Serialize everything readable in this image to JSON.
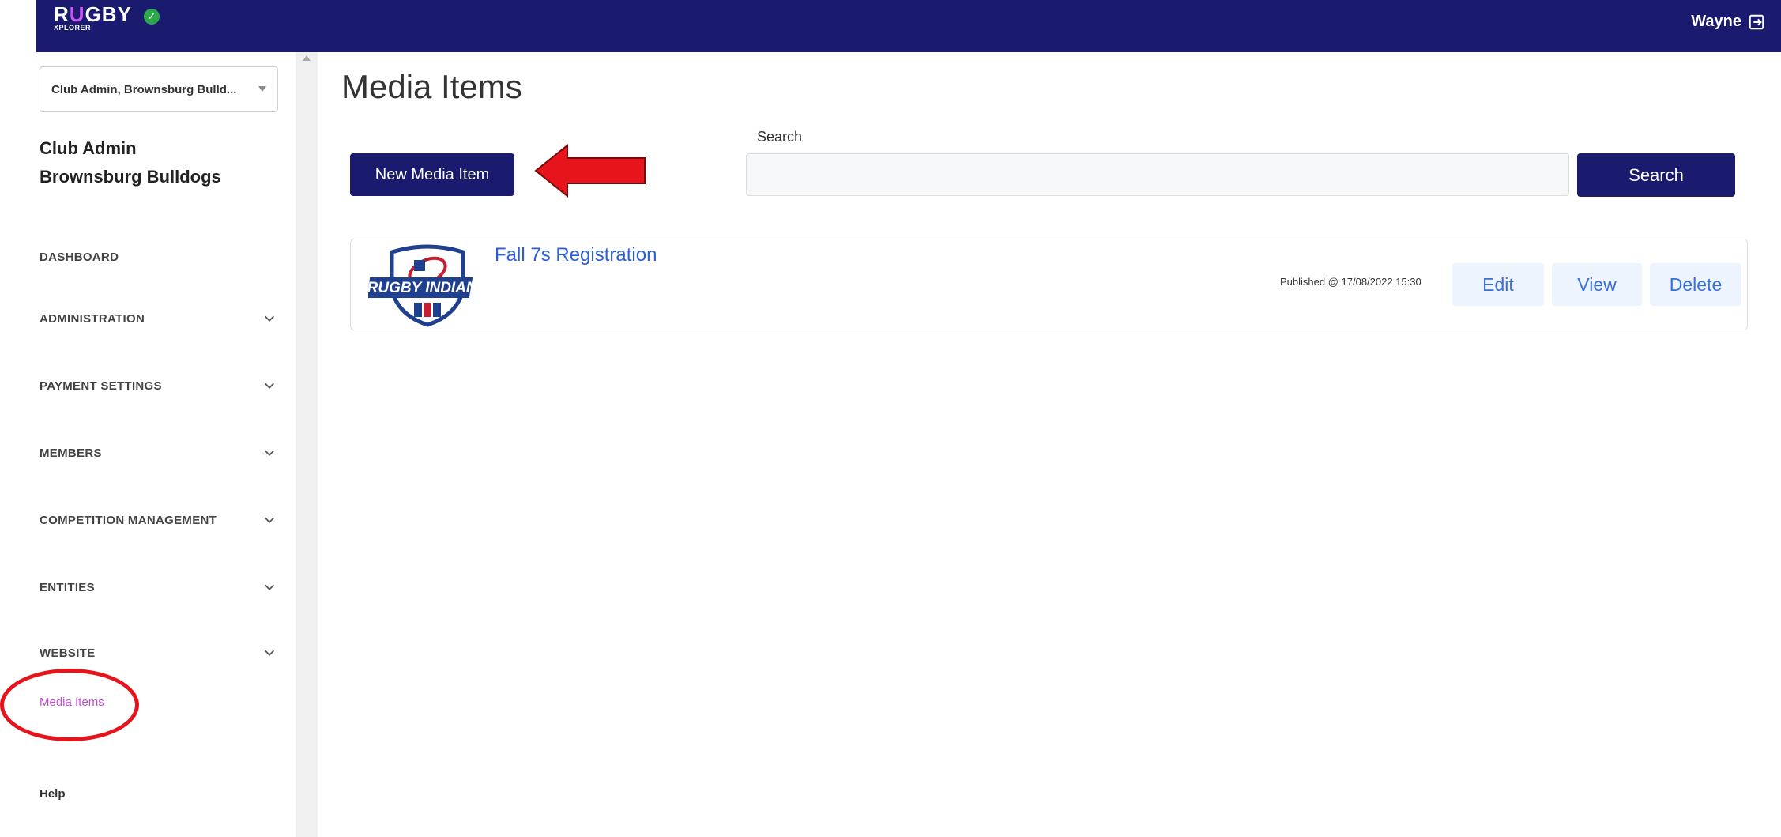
{
  "header": {
    "logo_text_prefix": "R",
    "logo_text_accent": "U",
    "logo_text_suffix": "GBY",
    "logo_subtext": "XPLORER",
    "user_name": "Wayne",
    "logout_icon": "logout-icon"
  },
  "sidebar": {
    "club_select_value": "Club Admin, Brownsburg Bulld...",
    "role_title": "Club Admin",
    "club_name": "Brownsburg Bulldogs",
    "items": [
      {
        "label": "DASHBOARD",
        "has_chevron": false
      },
      {
        "label": "ADMINISTRATION",
        "has_chevron": true
      },
      {
        "label": "PAYMENT SETTINGS",
        "has_chevron": true
      },
      {
        "label": "MEMBERS",
        "has_chevron": true
      },
      {
        "label": "COMPETITION MANAGEMENT",
        "has_chevron": true
      },
      {
        "label": "ENTITIES",
        "has_chevron": true
      },
      {
        "label": "WEBSITE",
        "has_chevron": true
      }
    ],
    "active_subitem": "Media Items",
    "help_label": "Help"
  },
  "main": {
    "page_title": "Media Items",
    "new_button_label": "New Media Item",
    "search_label": "Search",
    "search_placeholder": "",
    "search_button_label": "Search",
    "media_items": [
      {
        "title": "Fall 7s Registration",
        "thumbnail_text": "RUGBY INDIANA",
        "published": "Published @ 17/08/2022 15:30",
        "edit_label": "Edit",
        "view_label": "View",
        "delete_label": "Delete"
      }
    ]
  },
  "colors": {
    "brand_navy": "#1a1a6e",
    "accent_purple": "#c64bd6",
    "link_blue": "#2b5fd9",
    "annotation_red": "#e8141c"
  }
}
